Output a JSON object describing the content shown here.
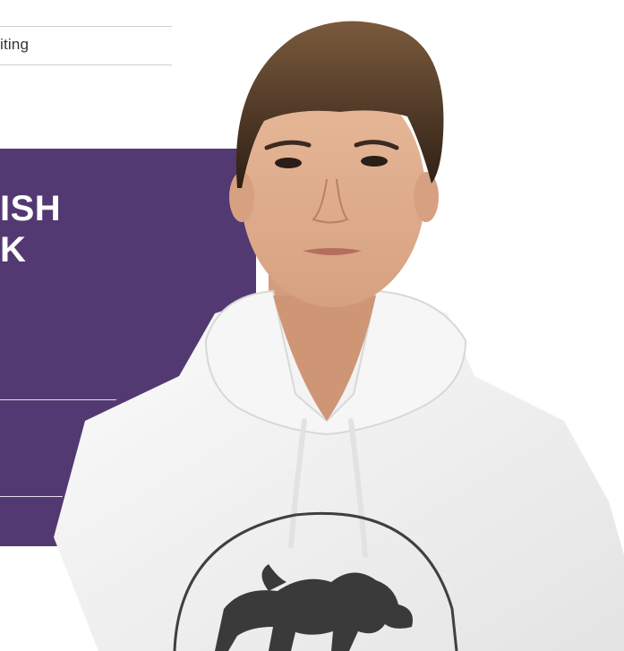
{
  "top_label": "iting",
  "headline": {
    "line1": "ISH",
    "line2": "K"
  },
  "colors": {
    "panel": "#533971",
    "hoodie": "#f1f2f1",
    "hair": "#3e2a1f"
  },
  "icons": {
    "hoodie_print": "lion-emblem-icon"
  }
}
